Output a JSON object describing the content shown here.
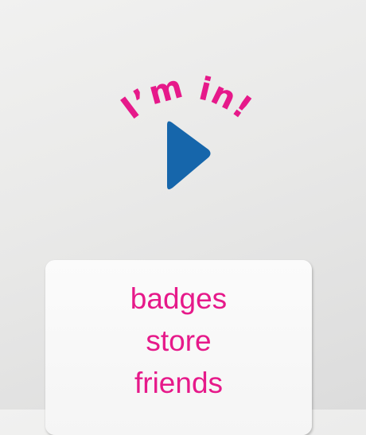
{
  "logo": {
    "tagline": "I’m in!",
    "icon": "play-icon"
  },
  "menu": {
    "items": [
      {
        "label": "badges"
      },
      {
        "label": "store"
      },
      {
        "label": "friends"
      }
    ]
  },
  "colors": {
    "accent_pink": "#e6198a",
    "play_blue": "#1666ab",
    "card_bg": "#f8f8f8"
  }
}
